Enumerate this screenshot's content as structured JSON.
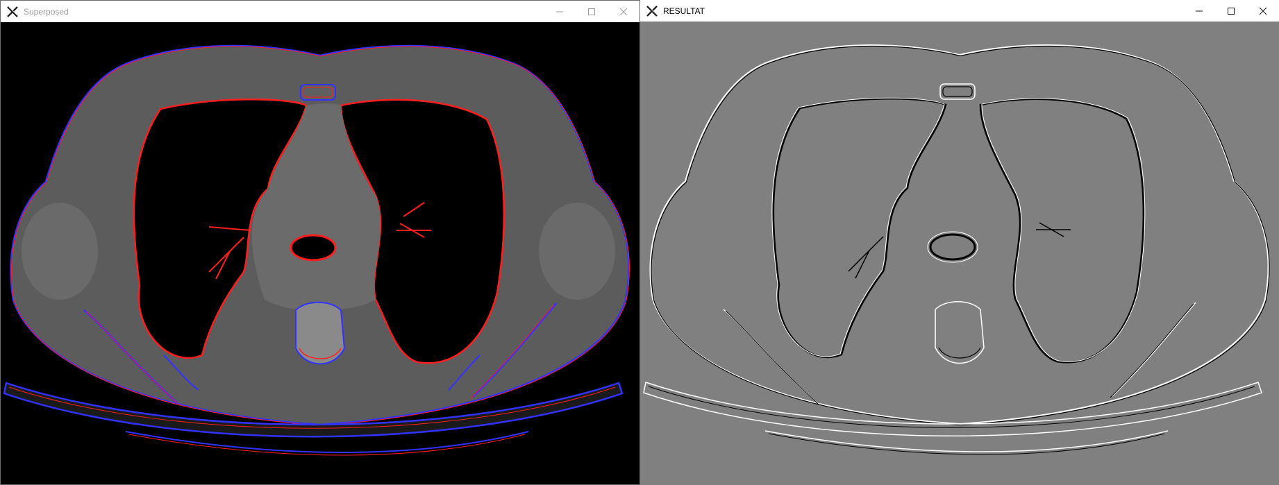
{
  "windows": {
    "left": {
      "title": "Superposed",
      "icon": "x-app-icon"
    },
    "right": {
      "title": "RESULTAT",
      "icon": "x-app-icon"
    }
  },
  "controls": {
    "minimize": "minimize-icon",
    "maximize": "maximize-icon",
    "close": "close-icon"
  },
  "colors": {
    "overlay_background": "#000000",
    "body_tissue": "#5c5c5c",
    "mediastinum": "#6b6b6b",
    "contour_red": "#ff1e1e",
    "contour_blue": "#3232ff",
    "edge_background": "#808080",
    "edge_white": "#ffffff",
    "edge_black": "#000000"
  }
}
